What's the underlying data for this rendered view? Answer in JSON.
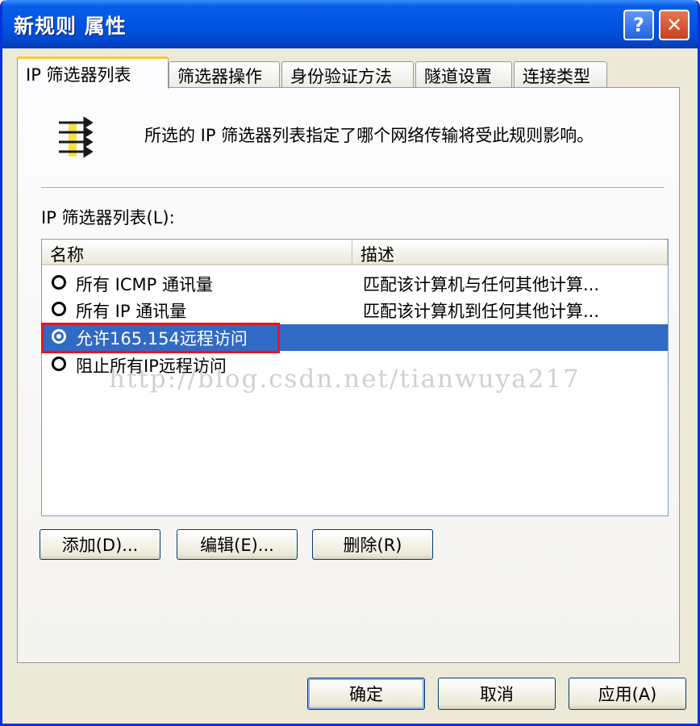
{
  "window": {
    "title": "新规则 属性",
    "help_label": "?",
    "close_label": "✕"
  },
  "tabs": [
    {
      "label": "IP 筛选器列表",
      "active": true
    },
    {
      "label": "筛选器操作",
      "active": false
    },
    {
      "label": "身份验证方法",
      "active": false
    },
    {
      "label": "隧道设置",
      "active": false
    },
    {
      "label": "连接类型",
      "active": false
    }
  ],
  "panel": {
    "icon": "ip-filter-list-icon",
    "description": "所选的 IP 筛选器列表指定了哪个网络传输将受此规则影响。",
    "list_label": "IP 筛选器列表(L):"
  },
  "list": {
    "columns": [
      "名称",
      "描述"
    ],
    "rows": [
      {
        "name": "所有 ICMP 通讯量",
        "description": "匹配该计算机与任何其他计算...",
        "checked": false,
        "selected": false
      },
      {
        "name": "所有 IP 通讯量",
        "description": "匹配该计算机到任何其他计算...",
        "checked": false,
        "selected": false
      },
      {
        "name": "允许165.154远程访问",
        "description": "",
        "checked": true,
        "selected": true
      },
      {
        "name": "阻止所有IP远程访问",
        "description": "",
        "checked": false,
        "selected": false
      }
    ],
    "watermark": "http://blog.csdn.net/tianwuya217"
  },
  "list_buttons": {
    "add": "添加(D)...",
    "edit": "编辑(E)...",
    "delete": "删除(R)"
  },
  "footer_buttons": {
    "ok": "确定",
    "cancel": "取消",
    "apply": "应用(A)"
  },
  "colors": {
    "titlebar": "#0054e3",
    "selection": "#316ac5",
    "annotation_box": "#e8141a",
    "tab_highlight": "#ffc83c"
  }
}
